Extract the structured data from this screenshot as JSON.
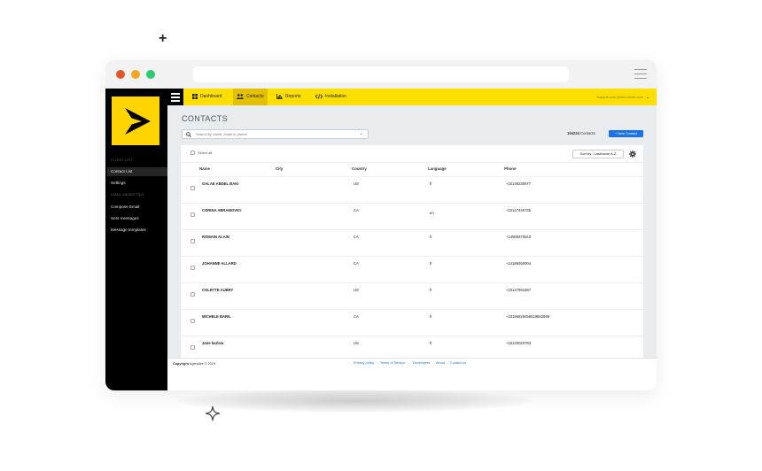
{
  "app": {
    "nav": {
      "items": [
        {
          "label": "Dashboard",
          "icon": "grid-icon",
          "active": false
        },
        {
          "label": "Contacts",
          "icon": "users-icon",
          "active": true
        },
        {
          "label": "Reports",
          "icon": "bar-chart-icon",
          "active": false
        },
        {
          "label": "Installation",
          "icon": "code-icon",
          "active": false
        }
      ],
      "user_label": "Sample.user@demomail.com"
    },
    "sidebar": {
      "section_client": "CLIENT LIST",
      "section_email": "EMAIL MARKETING",
      "items": [
        {
          "label": "Contact List",
          "active": true
        },
        {
          "label": "Settings",
          "active": false
        },
        {
          "label": "Compose Email",
          "active": false
        },
        {
          "label": "Sent messages",
          "active": false
        },
        {
          "label": "Message templates",
          "active": false
        }
      ]
    },
    "page": {
      "title": "CONTACTS",
      "search_placeholder": "Search by name, email or phone",
      "count_number": "104224",
      "count_label": "Contacts",
      "new_contact_label": "+ New Contact",
      "select_all_label": "Select all",
      "sort_label": "Sort by : Lastname A-Z"
    },
    "table": {
      "columns": [
        "Name",
        "City",
        "Country",
        "Language",
        "Phone"
      ],
      "rows": [
        {
          "name": "GALAE ABDEL BAKI",
          "city": "",
          "country": "US",
          "language": "fr",
          "phone": "+15148230977"
        },
        {
          "name": "CORINA ABRAMOVICI",
          "city": "",
          "country": "CA",
          "language": "en",
          "phone": "+15147445735"
        },
        {
          "name": "ROMAIN ALAIN",
          "city": "",
          "country": "CA",
          "language": "fr",
          "phone": "+14509370543"
        },
        {
          "name": "JOHANNE ALLARD",
          "city": "",
          "country": "CA",
          "language": "fr",
          "phone": "+14188450004"
        },
        {
          "name": "COLETTE AUBRY",
          "city": "",
          "country": "US",
          "language": "fr",
          "phone": "+15147691687"
        },
        {
          "name": "MICHELE BARIL",
          "city": "",
          "country": "CA",
          "language": "fr",
          "phone": "+18196828456819682898"
        },
        {
          "name": "Jane barlow",
          "city": "",
          "country": "US",
          "language": "fr",
          "phone": "+15140020793"
        }
      ]
    },
    "footer": {
      "copyright_label": "Copyright",
      "copyright_text": "Agendize © 2019",
      "links": [
        "Privacy policy",
        "Terms of Service",
        "Developers",
        "About",
        "Contact us"
      ]
    },
    "colors": {
      "brand_yellow": "#ffdf00",
      "primary_blue": "#1a73e8",
      "sidebar_black": "#000000"
    }
  }
}
